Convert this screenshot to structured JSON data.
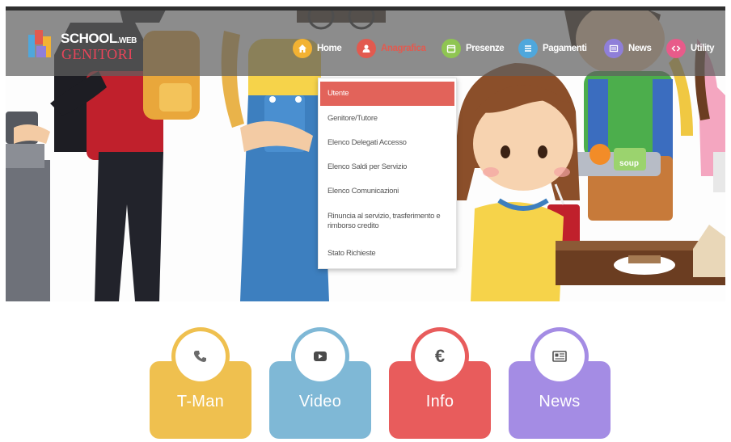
{
  "logo": {
    "school": "SCHOOL",
    "web": ".WEB",
    "genitori": "GENITORI"
  },
  "nav": {
    "items": [
      {
        "label": "Home",
        "icon": "home-icon",
        "color": "#f2b233"
      },
      {
        "label": "Anagrafica",
        "icon": "user-icon",
        "color": "#e25a4f"
      },
      {
        "label": "Presenze",
        "icon": "calendar-icon",
        "color": "#8fc552"
      },
      {
        "label": "Pagamenti",
        "icon": "list-icon",
        "color": "#4fa7dc"
      },
      {
        "label": "News",
        "icon": "newspaper-icon",
        "color": "#8f7fd9"
      },
      {
        "label": "Utility",
        "icon": "code-icon",
        "color": "#e85b8a"
      }
    ]
  },
  "dropdown": {
    "items": [
      {
        "label": "Utente"
      },
      {
        "label": "Genitore/Tutore"
      },
      {
        "label": "Elenco Delegati Accesso"
      },
      {
        "label": "Elenco Saldi per Servizio"
      },
      {
        "label": "Elenco Comunicazioni"
      },
      {
        "label": "Rinuncia al servizio, trasferimento e rimborso credito"
      },
      {
        "label": "Stato Richieste"
      }
    ]
  },
  "scene": {
    "soup_label": "soup"
  },
  "tiles": [
    {
      "label": "T-Man",
      "icon": "phone-icon",
      "color": "#efc04f"
    },
    {
      "label": "Video",
      "icon": "play-icon",
      "color": "#7fb8d6"
    },
    {
      "label": "Info",
      "icon": "euro-icon",
      "color": "#e85c5c",
      "glyph": "€"
    },
    {
      "label": "News",
      "icon": "newspaper-icon",
      "color": "#a48ce4"
    }
  ]
}
